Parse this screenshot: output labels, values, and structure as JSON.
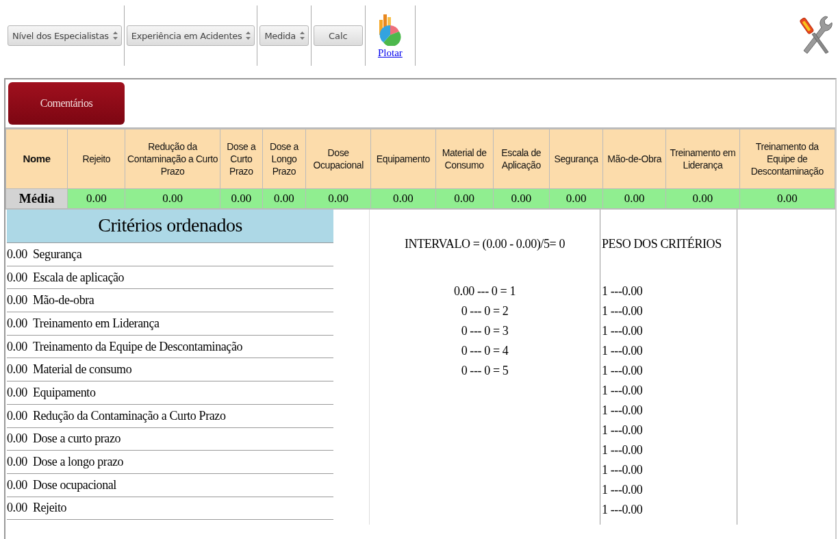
{
  "toolbar": {
    "selects": [
      {
        "label": "Nível dos Especialistas"
      },
      {
        "label": "Experiência em Acidentes"
      },
      {
        "label": "Medida"
      }
    ],
    "calc_button": "Calc",
    "plot_link": "Plotar"
  },
  "comments_button": "Comentários",
  "table": {
    "columns": [
      "Nome",
      "Rejeito",
      "Redução da Contaminação a Curto Prazo",
      "Dose a Curto Prazo",
      "Dose a Longo Prazo",
      "Dose Ocupacional",
      "Equipamento",
      "Material de Consumo",
      "Escala de Aplicação",
      "Segurança",
      "Mão-de-Obra",
      "Treinamento em Liderança",
      "Treinamento da Equipe de Descontaminação"
    ],
    "rows": [
      {
        "label": "Média",
        "values": [
          "0.00",
          "0.00",
          "0.00",
          "0.00",
          "0.00",
          "0.00",
          "0.00",
          "0.00",
          "0.00",
          "0.00",
          "0.00",
          "0.00"
        ]
      }
    ]
  },
  "ranking": {
    "title": "Critérios ordenados",
    "items": [
      {
        "score": "0.00",
        "name": "Segurança"
      },
      {
        "score": "0.00",
        "name": "Escala de aplicação"
      },
      {
        "score": "0.00",
        "name": "Mão-de-obra"
      },
      {
        "score": "0.00",
        "name": "Treinamento em Liderança"
      },
      {
        "score": "0.00",
        "name": "Treinamento da Equipe de Descontaminação"
      },
      {
        "score": "0.00",
        "name": "Material de consumo"
      },
      {
        "score": "0.00",
        "name": "Equipamento"
      },
      {
        "score": "0.00",
        "name": "Redução da Contaminação a Curto Prazo"
      },
      {
        "score": "0.00",
        "name": "Dose a curto prazo"
      },
      {
        "score": "0.00",
        "name": "Dose a longo prazo"
      },
      {
        "score": "0.00",
        "name": "Dose ocupacional"
      },
      {
        "score": "0.00",
        "name": "Rejeito"
      }
    ]
  },
  "interval": {
    "formula": "INTERVALO = (0.00 - 0.00)/5= 0",
    "classes": [
      "0.00 --- 0 = 1",
      "0 --- 0 = 2",
      "0 --- 0 = 3",
      "0 --- 0 = 4",
      "0 --- 0 = 5"
    ]
  },
  "weights": {
    "title": "PESO DOS CRITÉRIOS",
    "items": [
      "1 ---0.00",
      "1 ---0.00",
      "1 ---0.00",
      "1 ---0.00",
      "1 ---0.00",
      "1 ---0.00",
      "1 ---0.00",
      "1 ---0.00",
      "1 ---0.00",
      "1 ---0.00",
      "1 ---0.00",
      "1 ---0.00"
    ]
  }
}
